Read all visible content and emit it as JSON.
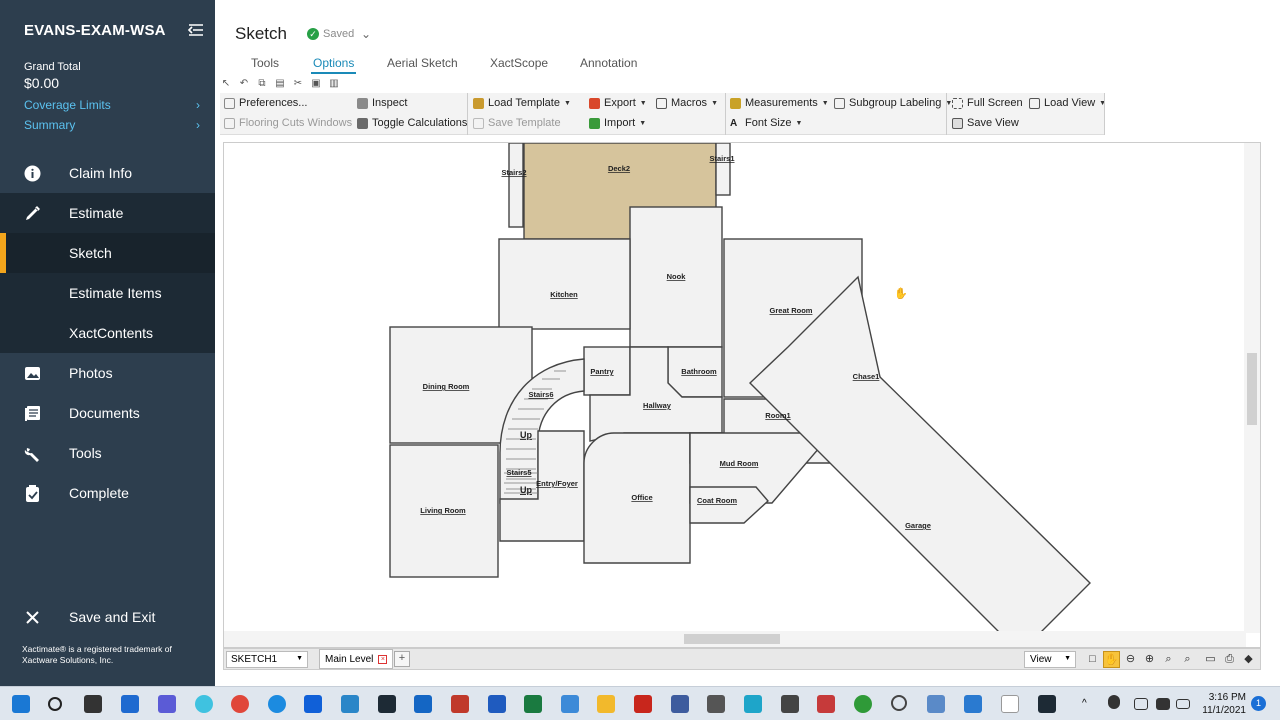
{
  "sidebar": {
    "title": "EVANS-EXAM-WSA",
    "grand_total_label": "Grand Total",
    "grand_total_value": "$0.00",
    "links": [
      {
        "label": "Coverage Limits"
      },
      {
        "label": "Summary"
      }
    ],
    "nav": [
      {
        "label": "Claim Info",
        "icon": "info-icon"
      },
      {
        "label": "Estimate",
        "icon": "pen-icon"
      },
      {
        "label": "Sketch",
        "icon": ""
      },
      {
        "label": "Estimate Items",
        "icon": ""
      },
      {
        "label": "XactContents",
        "icon": ""
      },
      {
        "label": "Photos",
        "icon": "photos-icon"
      },
      {
        "label": "Documents",
        "icon": "documents-icon"
      },
      {
        "label": "Tools",
        "icon": "wrench-icon"
      },
      {
        "label": "Complete",
        "icon": "clipboard-check-icon"
      }
    ],
    "save_exit": "Save and Exit",
    "footer": "Xactimate® is a registered trademark of Xactware Solutions, Inc."
  },
  "header": {
    "title": "Sketch",
    "saved": "Saved",
    "tabs": [
      "Tools",
      "Options",
      "Aerial Sketch",
      "XactScope",
      "Annotation"
    ],
    "active_tab": "Options"
  },
  "ribbon": {
    "preferences": "Preferences...",
    "inspect": "Inspect",
    "flooring_cuts": "Flooring Cuts Windows",
    "toggle_calc": "Toggle Calculations",
    "load_template": "Load Template",
    "save_template": "Save Template",
    "export": "Export",
    "import": "Import",
    "macros": "Macros",
    "measurements": "Measurements",
    "font_size": "Font Size",
    "subgroup_labeling": "Subgroup Labeling",
    "full_screen": "Full Screen",
    "load_view": "Load View",
    "save_view": "Save View"
  },
  "floorplan": {
    "rooms": [
      "Deck2",
      "Stairs2",
      "Stairs1",
      "Nook",
      "Kitchen",
      "Great Room",
      "Dining Room",
      "Pantry",
      "Bathroom",
      "Chase1",
      "Stairs6",
      "Hallway",
      "Room1",
      "Up",
      "Mud Room",
      "Stairs5",
      "Entry/Foyer",
      "Up",
      "Office",
      "Coat Room",
      "Garage",
      "Living Room"
    ]
  },
  "bottom": {
    "sketch": "SKETCH1",
    "level": "Main Level",
    "view": "View"
  },
  "taskbar": {
    "time": "3:16 PM",
    "date": "11/1/2021",
    "notifications": "1"
  },
  "colors": {
    "sidebar": "#2d3e4e",
    "accent": "#1a8ab8",
    "active_bar": "#f3a51c",
    "deck": "#d6c49c"
  }
}
